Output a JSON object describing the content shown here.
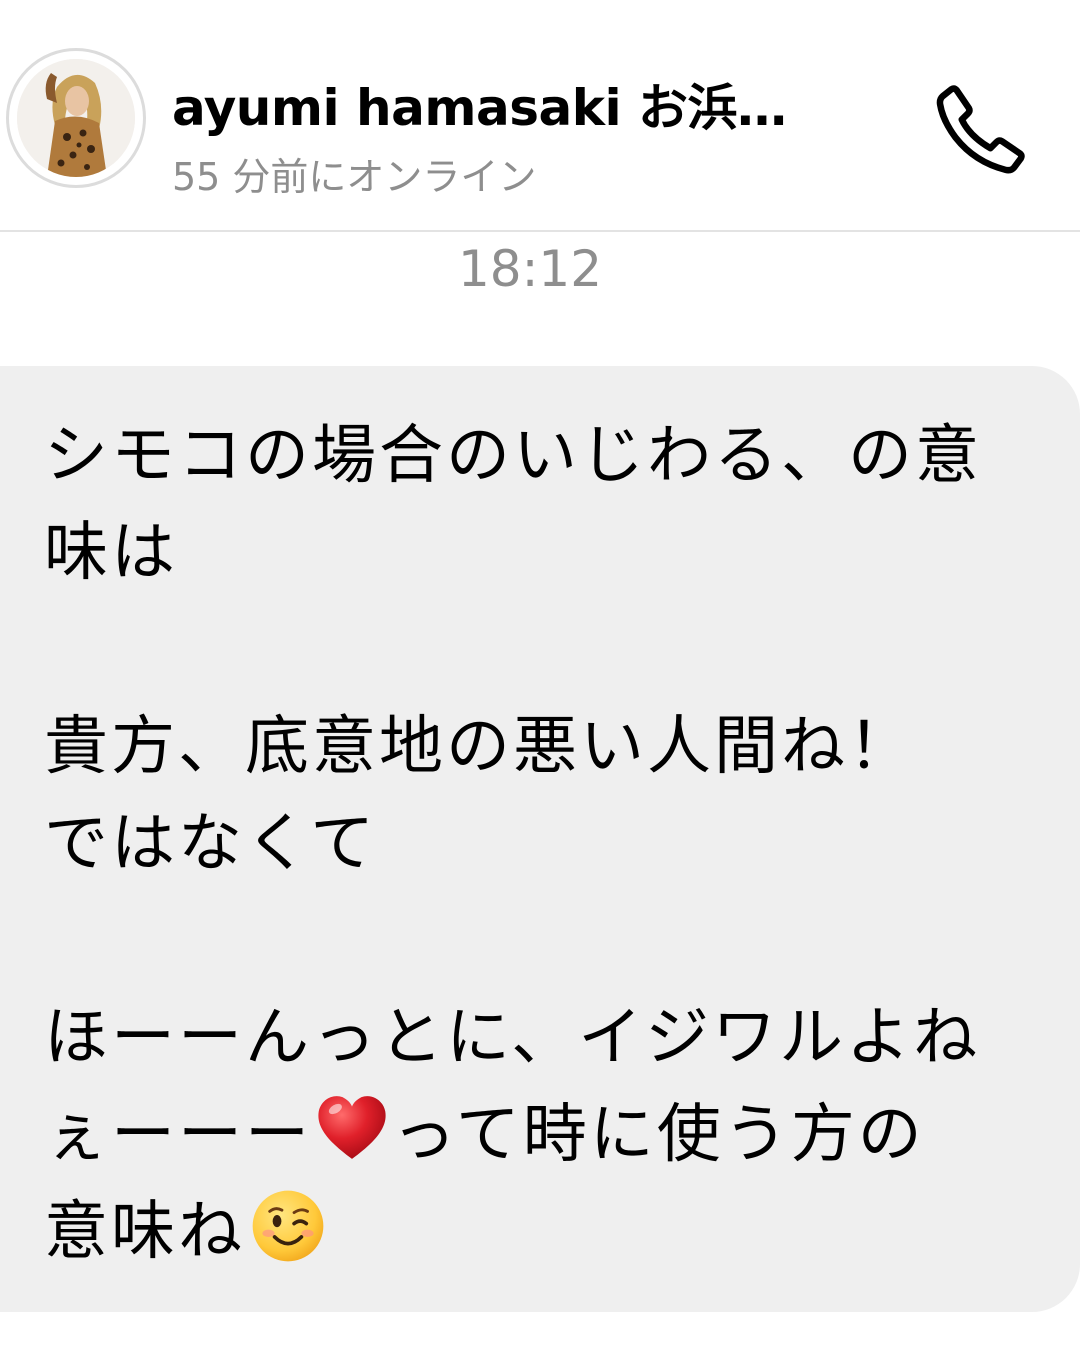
{
  "header": {
    "name": "ayumi hamasaki お浜…",
    "status": "55 分前にオンライン",
    "avatar_icon": "profile-photo",
    "call_icon": "phone-icon"
  },
  "thread": {
    "timestamp": "18:12"
  },
  "message": {
    "line1": "シモコの場合のいじわる、の意",
    "line2": "味は",
    "line3": "貴方、底意地の悪い人間ね！",
    "line4": "ではなくて",
    "line5": "ほーーんっとに、イジワルよね",
    "line6a": "ぇーーー",
    "line6b": "って時に使う方の",
    "line7": "意味ね",
    "emoji1": "red-heart",
    "emoji2": "winking-face"
  },
  "colors": {
    "bubble": "#efefef",
    "muted_text": "#8e8e8e",
    "divider": "#e3e3e3"
  }
}
